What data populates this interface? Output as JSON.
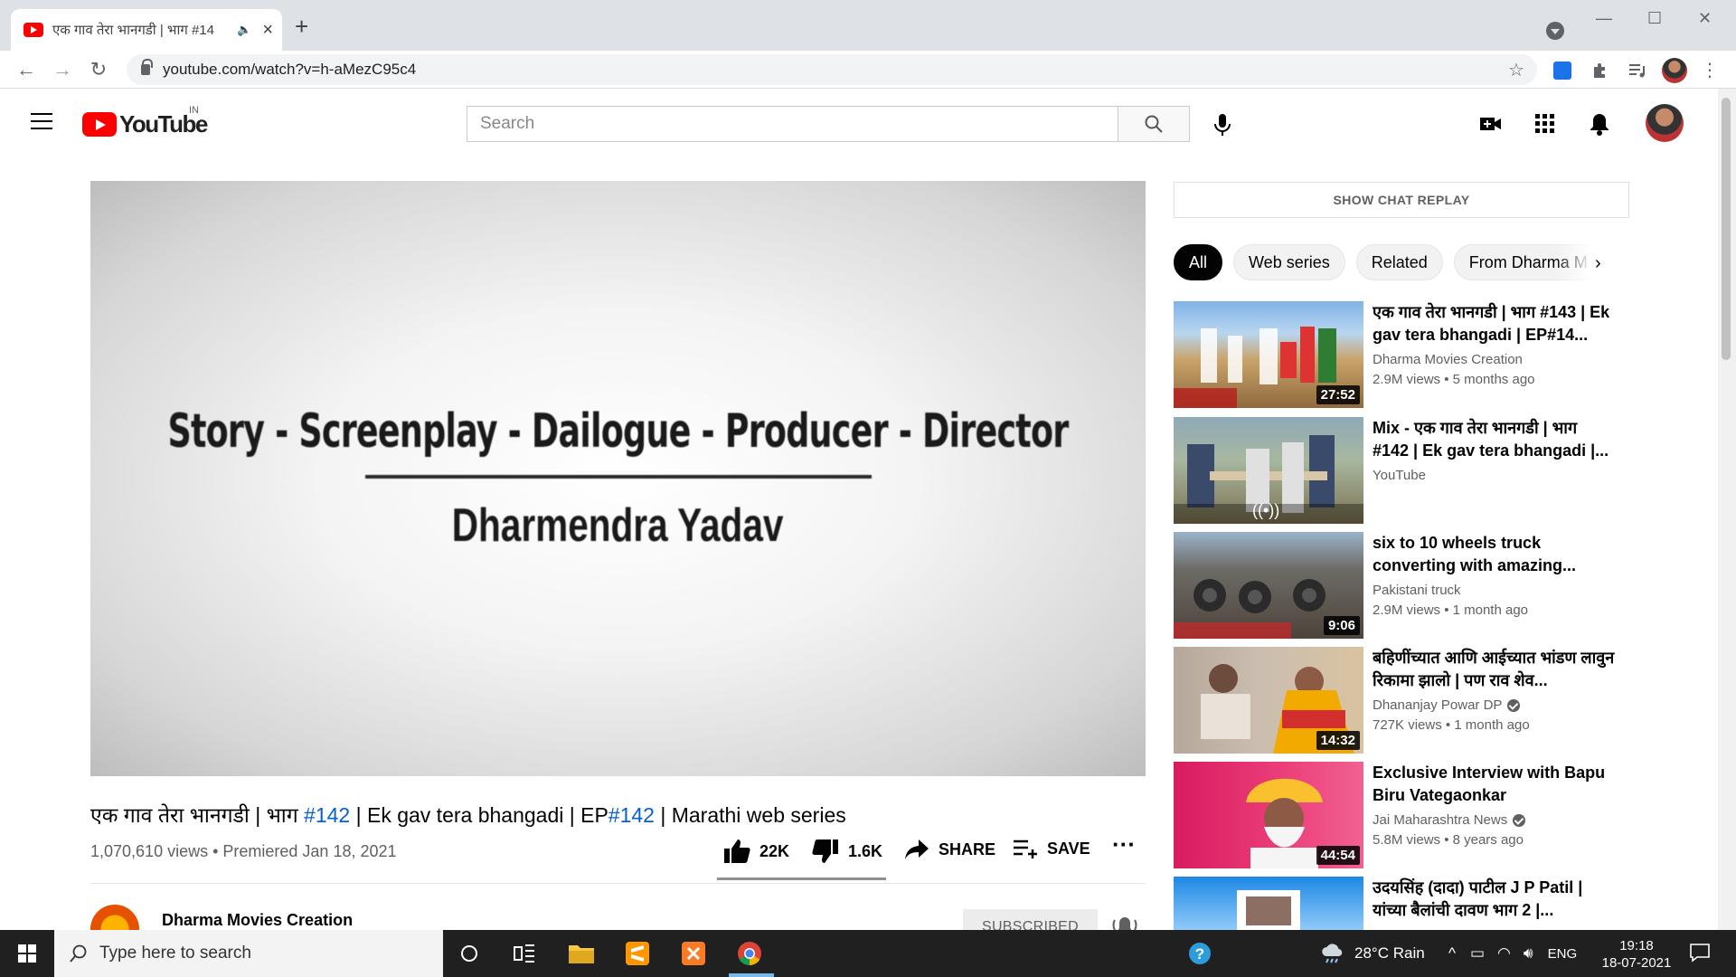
{
  "browser": {
    "tab_title": "एक गाव तेरा भानगडी | भाग #14",
    "url": "youtube.com/watch?v=h-aMezC95c4",
    "window_controls": {
      "minimize": "—",
      "maximize": "☐",
      "close": "✕"
    }
  },
  "header": {
    "logo_text": "YouTube",
    "country_code": "IN",
    "search_placeholder": "Search",
    "icons": [
      "menu-icon",
      "search-icon",
      "mic-icon",
      "create-video-icon",
      "apps-grid-icon",
      "notifications-bell-icon"
    ]
  },
  "player": {
    "credits_line": "Story - Screenplay - Dailogue - Producer - Director",
    "director_name": "Dharmendra Yadav"
  },
  "video": {
    "title_parts": {
      "a": "एक गाव तेरा भानगडी | भाग ",
      "tag1": "#142",
      "b": " | Ek gav tera bhangadi | EP",
      "tag2": "#142",
      "c": " | Marathi web series"
    },
    "meta": "1,070,610 views • Premiered Jan 18, 2021",
    "likes": "22K",
    "dislikes": "1.6K",
    "share_label": "SHARE",
    "save_label": "SAVE",
    "channel_name": "Dharma Movies Creation",
    "subscribe_label": "SUBSCRIBED"
  },
  "sidebar": {
    "chat_replay_label": "SHOW CHAT REPLAY",
    "chips": [
      "All",
      "Web series",
      "Related",
      "From Dharma M"
    ],
    "recommendations": [
      {
        "title": "एक गाव तेरा भानगडी | भाग #143 | Ek gav tera bhangadi | EP#14...",
        "channel": "Dharma Movies Creation",
        "views": "2.9M views • 5 months ago",
        "duration": "27:52",
        "verified": false
      },
      {
        "title": "Mix - एक गाव तेरा भानगडी | भाग #142 | Ek gav tera bhangadi |...",
        "channel": "YouTube",
        "views": "",
        "duration": "",
        "verified": false,
        "mix": true
      },
      {
        "title": "six to 10 wheels truck converting with amazing...",
        "channel": "Pakistani truck",
        "views": "2.9M views • 1 month ago",
        "duration": "9:06",
        "verified": false
      },
      {
        "title": "बहिणींच्यात आणि आईच्यात भांडण लावुन रिकामा झालो | पण राव शेव...",
        "channel": "Dhananjay Powar DP",
        "views": "727K views • 1 month ago",
        "duration": "14:32",
        "verified": true
      },
      {
        "title": "Exclusive Interview with Bapu Biru Vategaonkar",
        "channel": "Jai Maharashtra News",
        "views": "5.8M views • 8 years ago",
        "duration": "44:54",
        "verified": true
      },
      {
        "title": "उदयसिंह (दादा) पाटील J P Patil | यांच्या बैलांची दावण भाग 2 |...",
        "channel": "",
        "views": "",
        "duration": "",
        "verified": false
      }
    ]
  },
  "taskbar": {
    "search_placeholder": "Type here to search",
    "weather": "28°C  Rain",
    "language": "ENG",
    "time": "19:18",
    "date": "18-07-2021"
  }
}
